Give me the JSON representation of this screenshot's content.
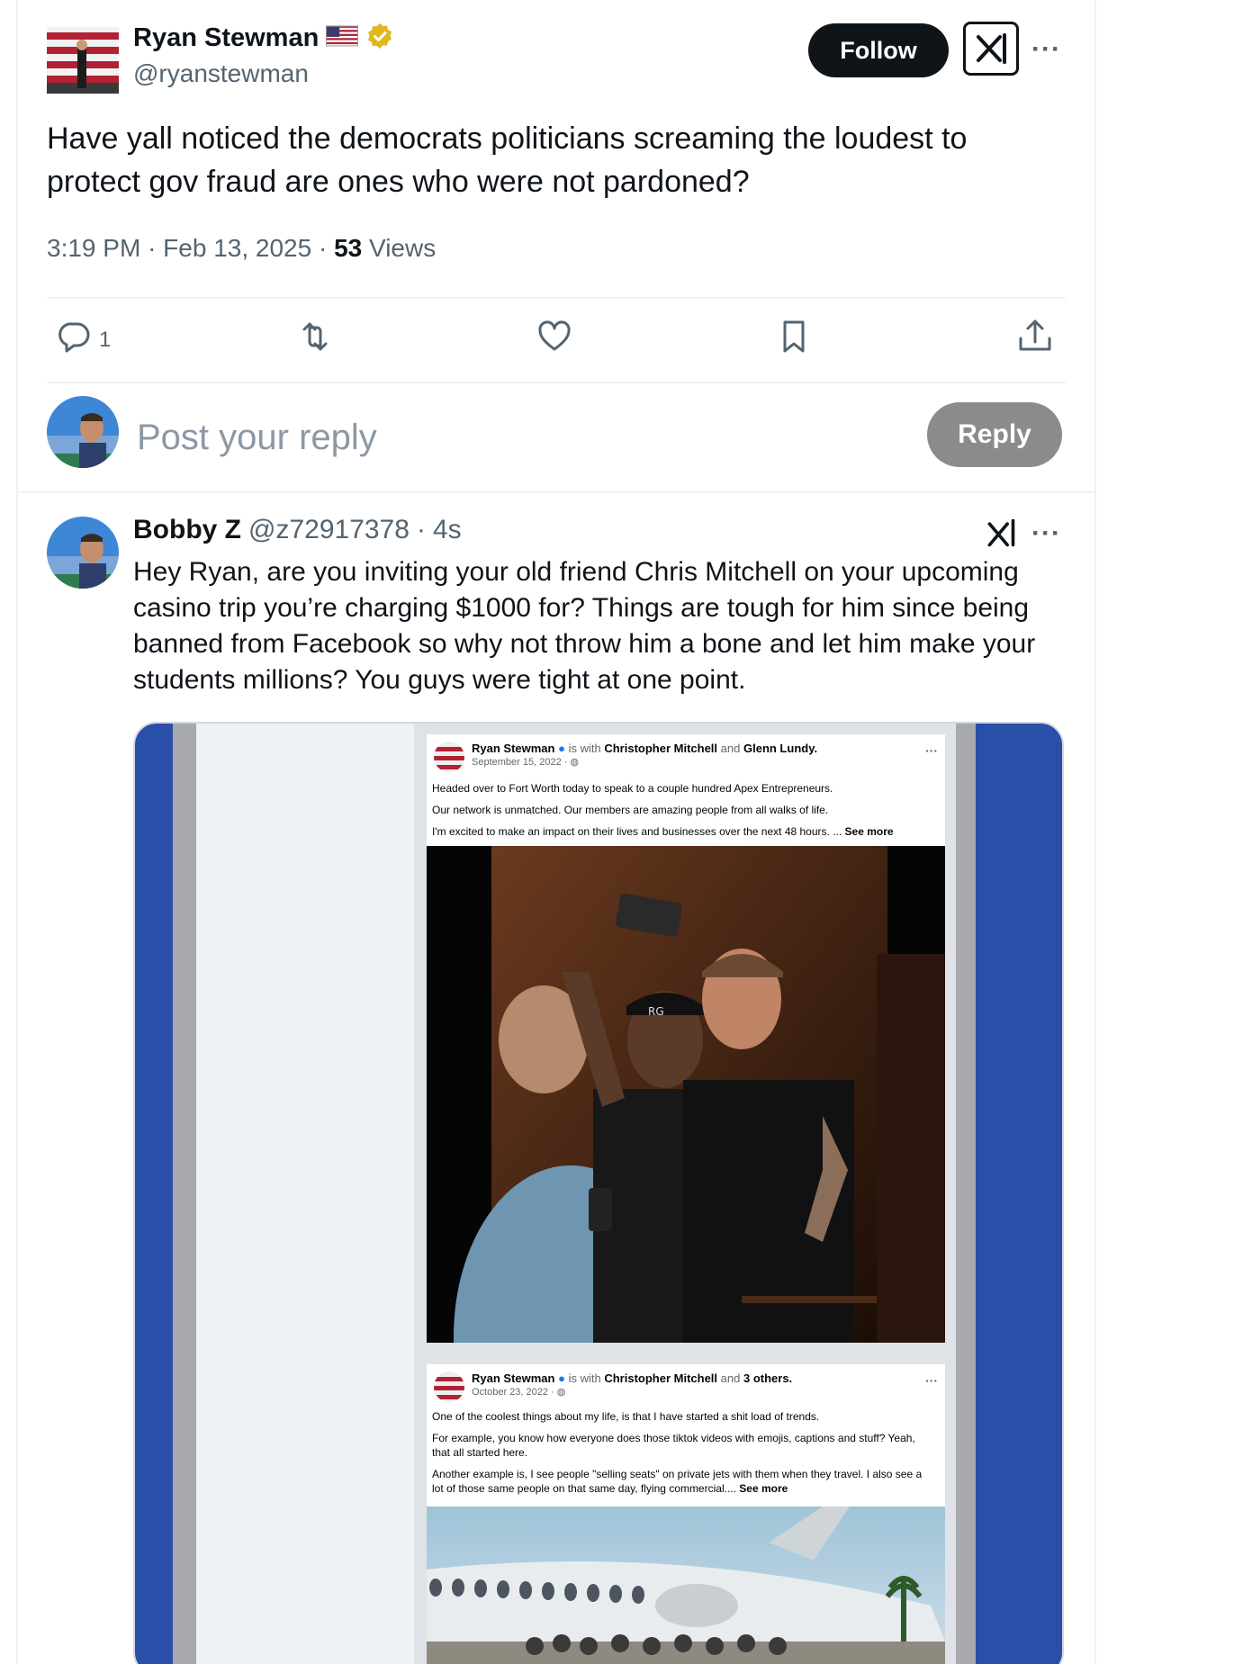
{
  "tweet": {
    "author_name": "Ryan Stewman",
    "author_handle": "@ryanstewman",
    "follow_label": "Follow",
    "text": "Have yall noticed the democrats politicians screaming the loudest to protect gov fraud are ones who were not pardoned?",
    "time": "3:19 PM",
    "date": "Feb 13, 2025",
    "views_count": "53",
    "views_label": "Views",
    "reply_count": "1",
    "more_label": "···"
  },
  "composer": {
    "placeholder": "Post your reply",
    "reply_label": "Reply"
  },
  "reply": {
    "author_name": "Bobby Z",
    "author_handle": "@z72917378",
    "time_ago": "4s",
    "text": "Hey Ryan, are you inviting your old friend Chris Mitchell on your upcoming casino trip you’re charging $1000 for? Things are tough for him since being banned from Facebook so why not throw him a bone and let him make your students millions? You guys were tight at one point.",
    "more_label": "···"
  },
  "media": {
    "post1": {
      "author": "Ryan Stewman",
      "with_text": "is with",
      "tagged1": "Christopher Mitchell",
      "and_text": "and",
      "tagged2": "Glenn Lundy.",
      "date": "September 15, 2022 ·",
      "line1": "Headed over to Fort Worth today to speak to a couple hundred Apex Entrepreneurs.",
      "line2": "Our network is unmatched. Our members are amazing people from all walks of life.",
      "line3": "I'm excited to make an impact on their lives and businesses over the next 48 hours. ...",
      "see_more": "See more",
      "cap_text": "RG"
    },
    "post2": {
      "author": "Ryan Stewman",
      "with_text": "is with",
      "tagged1": "Christopher Mitchell",
      "and_text": "and",
      "tagged2": "3 others.",
      "date": "October 23, 2022 ·",
      "line1": "One of the coolest things about my life, is that I have started a shit load of trends.",
      "line2": "For example, you know how everyone does those tiktok videos with emojis, captions and stuff? Yeah, that all started here.",
      "line3": "Another example is, I see people \"selling seats\" on private jets with them when they travel. I also see a lot of those same people on that same day, flying commercial....",
      "see_more": "See more"
    }
  },
  "colors": {
    "text_primary": "#0f1419",
    "text_secondary": "#536471",
    "placeholder": "#8b98a5",
    "follow_bg": "#0f1419",
    "reply_btn_bg": "#8b8b8b",
    "divider": "#eff3f4",
    "verified_gold": "#e2b719",
    "media_blue": "#2a4fa8"
  },
  "icons": [
    "us-flag-icon",
    "verified-badge-icon",
    "grok-icon",
    "more-icon",
    "reply-icon",
    "retweet-icon",
    "like-icon",
    "bookmark-icon",
    "share-icon",
    "facebook-verified-icon",
    "globe-icon"
  ]
}
